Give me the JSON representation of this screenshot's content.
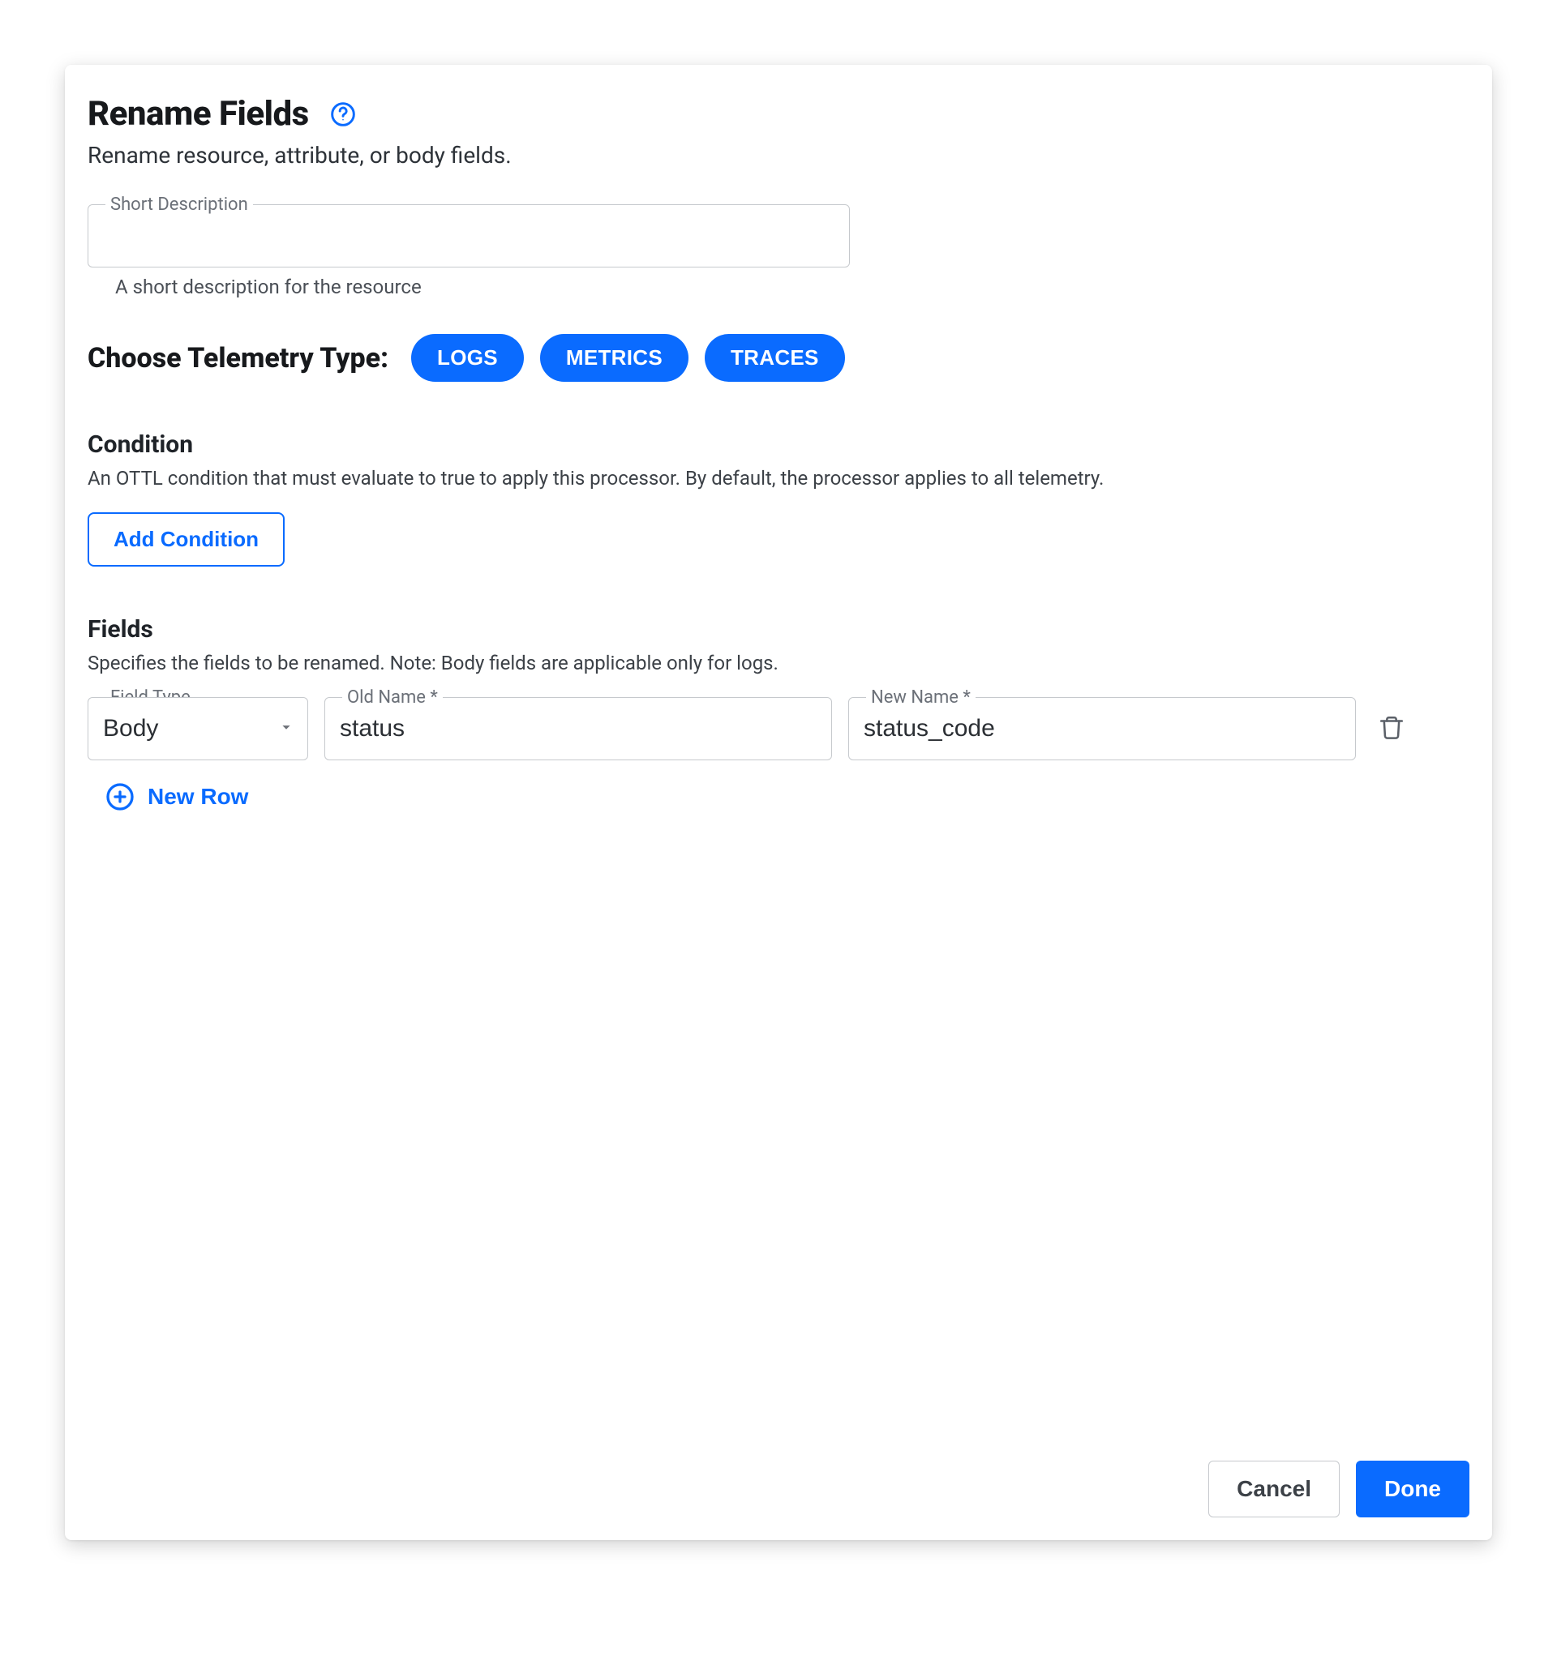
{
  "header": {
    "title": "Rename Fields",
    "subtitle": "Rename resource, attribute, or body fields."
  },
  "short_description": {
    "label": "Short Description",
    "value": "",
    "helper": "A short description for the resource"
  },
  "telemetry": {
    "label": "Choose Telemetry Type:",
    "options": [
      "LOGS",
      "METRICS",
      "TRACES"
    ]
  },
  "condition": {
    "title": "Condition",
    "desc": "An OTTL condition that must evaluate to true to apply this processor. By default, the processor applies to all telemetry.",
    "add_label": "Add Condition"
  },
  "fields": {
    "title": "Fields",
    "desc": "Specifies the fields to be renamed. Note: Body fields are applicable only for logs.",
    "labels": {
      "field_type": "Field Type",
      "old_name": "Old Name *",
      "new_name": "New Name *"
    },
    "rows": [
      {
        "type": "Body",
        "old": "status",
        "new": "status_code"
      }
    ],
    "add_row_label": "New Row"
  },
  "footer": {
    "cancel": "Cancel",
    "done": "Done"
  }
}
